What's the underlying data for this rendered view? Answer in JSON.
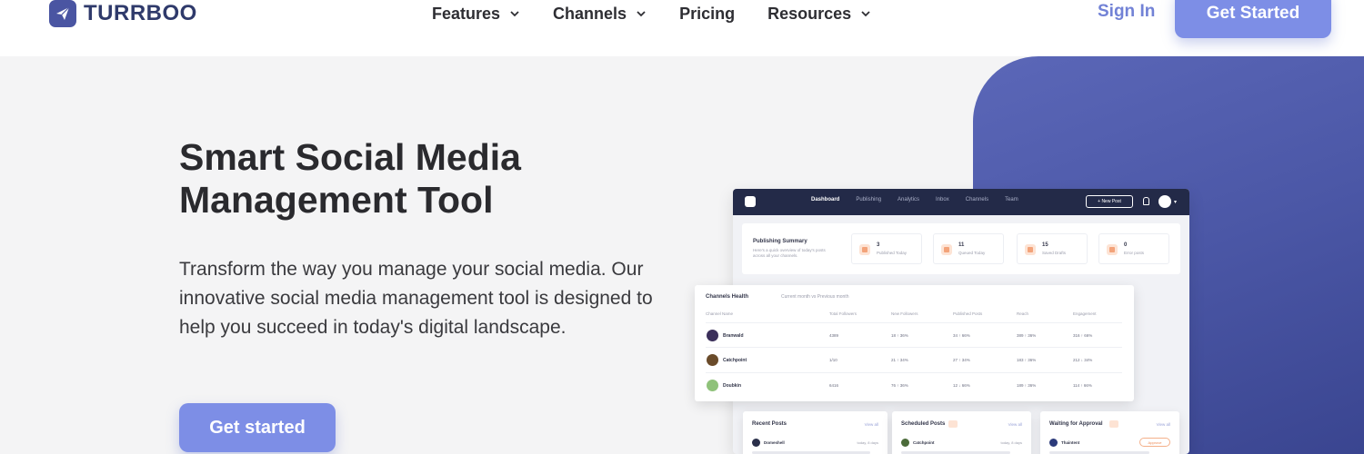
{
  "header": {
    "brand": "TURRBOO",
    "nav": [
      {
        "label": "Features",
        "has_dropdown": true
      },
      {
        "label": "Channels",
        "has_dropdown": true
      },
      {
        "label": "Pricing",
        "has_dropdown": false
      },
      {
        "label": "Resources",
        "has_dropdown": true
      }
    ],
    "sign_in": "Sign In",
    "get_started": "Get Started",
    "icons": {
      "logo": "paper-plane-icon",
      "dropdown": "chevron-down-icon"
    }
  },
  "hero": {
    "title_line1": "Smart Social Media",
    "title_line2": "Management Tool",
    "description": "Transform the way you manage your social media. Our innovative social media management tool is designed to help you succeed in today's digital landscape.",
    "cta": "Get started"
  },
  "dashboard": {
    "tabs": [
      "Dashboard",
      "Publishing",
      "Analytics",
      "Inbox",
      "Channels",
      "Team"
    ],
    "new_post": "+ New Post",
    "summary": {
      "title": "Publishing Summary",
      "subtitle": "Here's a quick overview of today's posts across all your channels.",
      "stats": [
        {
          "value": "3",
          "label": "Published Today"
        },
        {
          "value": "11",
          "label": "Queued Today"
        },
        {
          "value": "15",
          "label": "Saved Drafts"
        },
        {
          "value": "0",
          "label": "Error posts"
        }
      ]
    },
    "channels_health": {
      "title": "Channels Health",
      "note": "Current month vs Previous month",
      "columns": [
        "Channel Name",
        "Total Followers",
        "New Followers",
        "Published Posts",
        "Reach",
        "Engagement"
      ],
      "rows": [
        {
          "name": "Branwald",
          "values": [
            "4389",
            "18 ↑ 36%",
            "34 ↑ 66%",
            "389 ↑ 36%",
            "316 ↑ 66%"
          ]
        },
        {
          "name": "Catchpoint",
          "values": [
            "1/10",
            "21 ↑ 34%",
            "27 ↑ 34%",
            "183 ↑ 36%",
            "212 ↓ 34%"
          ]
        },
        {
          "name": "Doubkin",
          "values": [
            "6416",
            "76 ↑ 36%",
            "12 ↓ 66%",
            "189 ↑ 36%",
            "114 ↑ 66%"
          ]
        }
      ]
    },
    "cards": [
      {
        "title": "Recent Posts",
        "link": "View all",
        "author": "Domeshell",
        "time": "today, 8 days"
      },
      {
        "title": "Scheduled Posts",
        "link": "View all",
        "author": "Catchpoint",
        "time": "today, 8 days"
      },
      {
        "title": "Waiting for Approval",
        "link": "View all",
        "author": "Thaintent",
        "action": "Approve"
      }
    ]
  }
}
